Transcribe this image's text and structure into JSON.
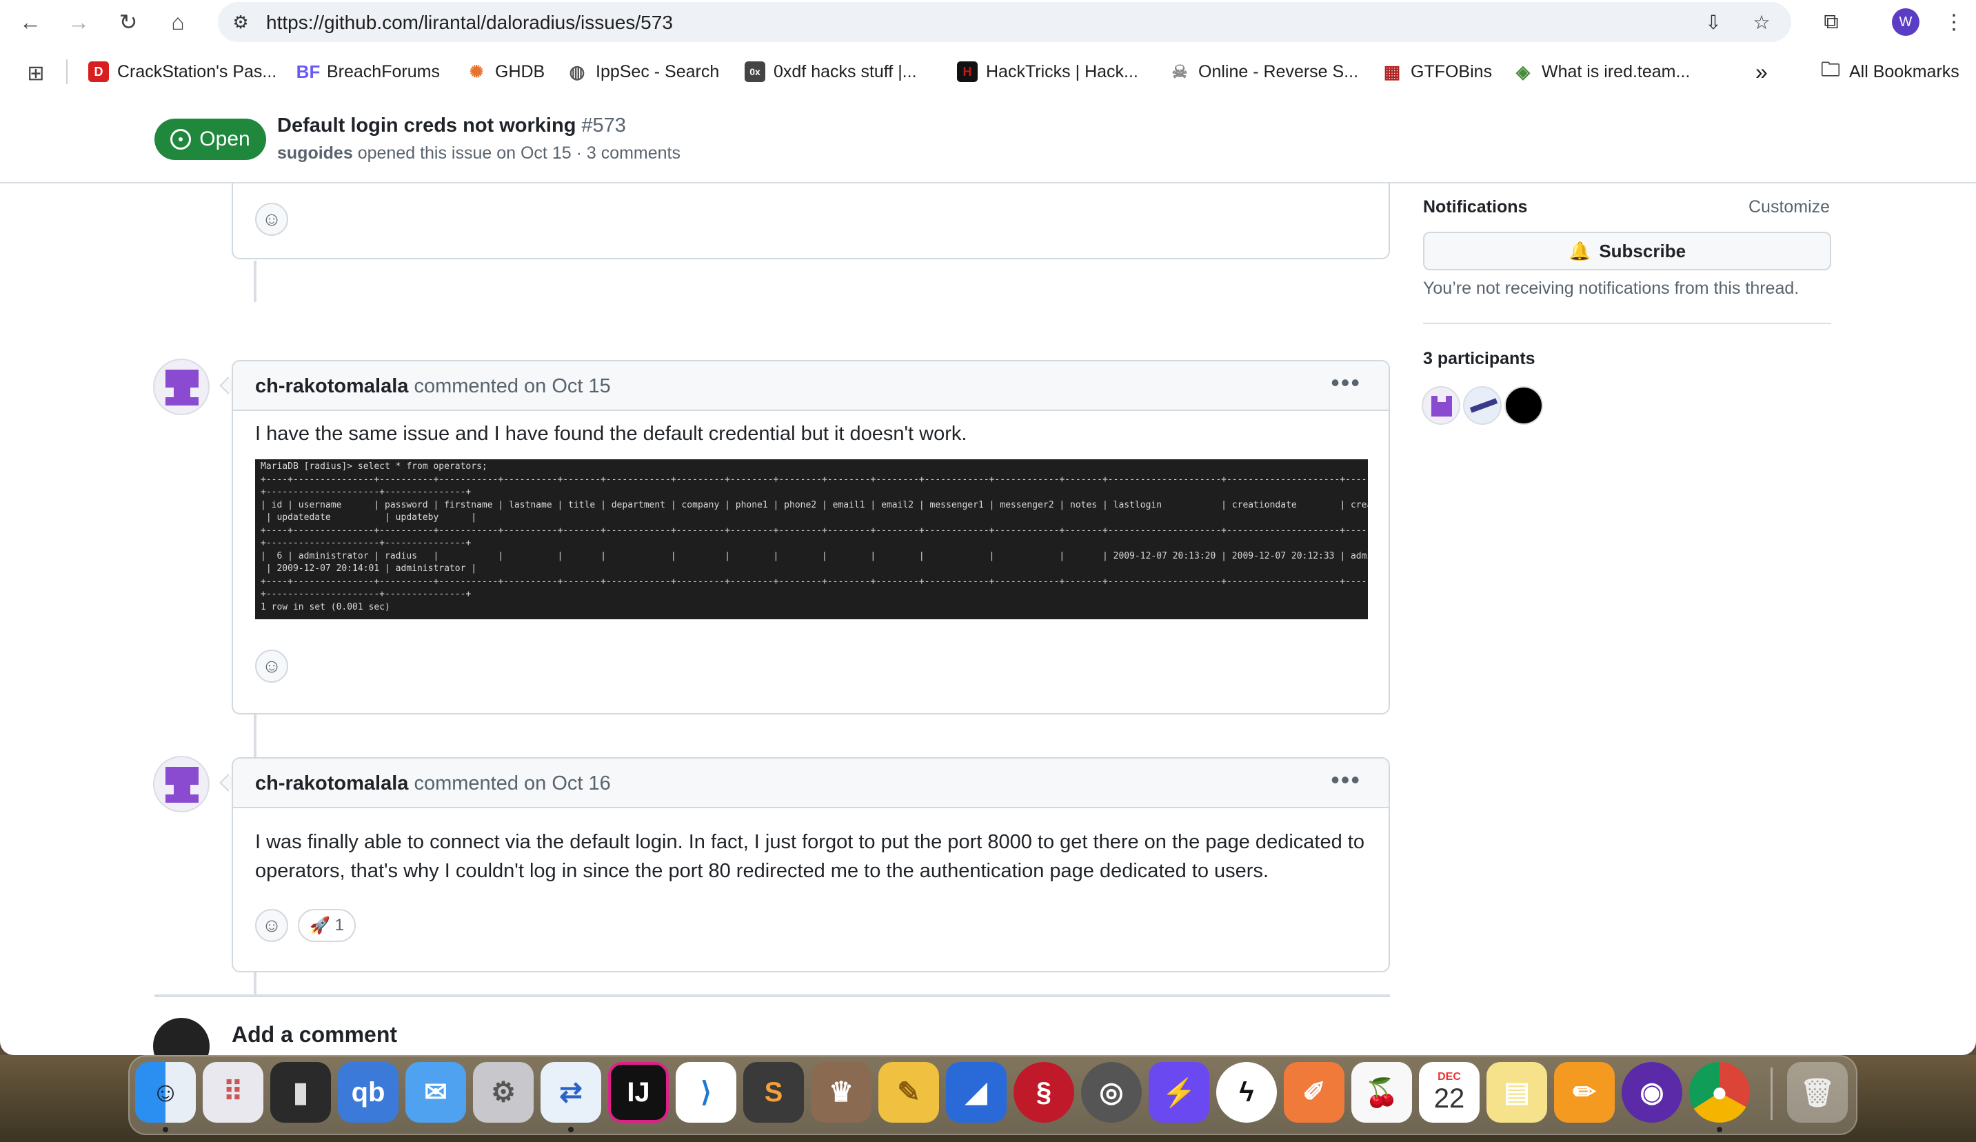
{
  "browser": {
    "url": "https://github.com/lirantal/daloradius/issues/573",
    "profile_initial": "W",
    "bookmarks": [
      {
        "label": "CrackStation's Pas...",
        "icon": "crackstation-icon",
        "color": "#d81e1e"
      },
      {
        "label": "BreachForums",
        "icon": "breachforums-icon",
        "color": "#6a5af9"
      },
      {
        "label": "GHDB",
        "icon": "ghdb-icon",
        "color": "#e8722a"
      },
      {
        "label": "IppSec - Search",
        "icon": "globe-icon",
        "color": "#666666"
      },
      {
        "label": "0xdf hacks stuff |...",
        "icon": "0xdf-icon",
        "color": "#444444"
      },
      {
        "label": "HackTricks | Hack...",
        "icon": "hacktricks-icon",
        "color": "#c4161c"
      },
      {
        "label": "Online - Reverse S...",
        "icon": "skull-icon",
        "color": "#888888"
      },
      {
        "label": "GTFOBins",
        "icon": "gtfobins-icon",
        "color": "#b22222"
      },
      {
        "label": "What is ired.team...",
        "icon": "iredteam-icon",
        "color": "#4a8c3a"
      }
    ],
    "bookmarks_overflow": "»",
    "all_bookmarks": "All Bookmarks"
  },
  "issue": {
    "state": "Open",
    "title": "Default login creds not working",
    "number": "#573",
    "author": "sugoides",
    "meta": "opened this issue on Oct 15 · 3 comments"
  },
  "comments": [
    {
      "author": "ch-rakotomalala",
      "action": "commented on Oct 15",
      "text": "I have the same issue and I have found the default credential but it doesn't work.",
      "terminal": "MariaDB [radius]> select * from operators;\n+----+---------------+----------+-----------+----------+-------+------------+---------+--------+--------+--------+--------+------------+------------+-------+---------------------+---------------------+-----------\n+---------------------+---------------+\n| id | username      | password | firstname | lastname | title | department | company | phone1 | phone2 | email1 | email2 | messenger1 | messenger2 | notes | lastlogin           | creationdate        | creationby\n | updatedate          | updateby      |\n+----+---------------+----------+-----------+----------+-------+------------+---------+--------+--------+--------+--------+------------+------------+-------+---------------------+---------------------+-----------\n+---------------------+---------------+\n|  6 | administrator | radius   |           |          |       |            |         |        |        |        |        |            |            |       | 2009-12-07 20:13:20 | 2009-12-07 20:12:33 | admin\n | 2009-12-07 20:14:01 | administrator |\n+----+---------------+----------+-----------+----------+-------+------------+---------+--------+--------+--------+--------+------------+------------+-------+---------------------+---------------------+-----------\n+---------------------+---------------+\n1 row in set (0.001 sec)"
    },
    {
      "author": "ch-rakotomalala",
      "action": "commented on Oct 16",
      "text": "I was finally able to connect via the default login. In fact, I just forgot to put the port 8000 to get there on the page dedicated to operators, that's why I couldn't log in since the port 80 redirected me to the authentication page dedicated to users.",
      "reaction_emoji": "🚀",
      "reaction_count": "1"
    }
  ],
  "sidebar": {
    "notifications_label": "Notifications",
    "customize": "Customize",
    "subscribe": "Subscribe",
    "not_receiving": "You’re not receiving notifications from this thread.",
    "participants_label": "3 participants"
  },
  "add_comment": "Add a comment",
  "dock": {
    "calendar_month": "DEC",
    "calendar_day": "22"
  }
}
